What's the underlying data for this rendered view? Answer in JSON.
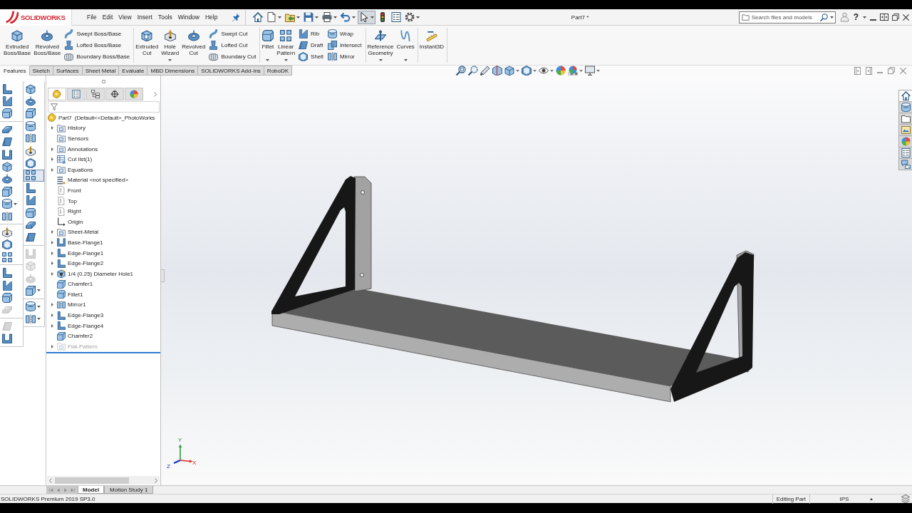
{
  "title_bar": {
    "logo": "SOLIDWORKS",
    "menu": [
      "File",
      "Edit",
      "View",
      "Insert",
      "Tools",
      "Window",
      "Help"
    ],
    "quick_access": [
      {
        "dropdown": false,
        "selected": false
      },
      {
        "dropdown": true,
        "selected": false
      },
      {
        "dropdown": true,
        "selected": false
      },
      {
        "dropdown": true,
        "selected": false
      },
      {
        "dropdown": true,
        "selected": false
      },
      {
        "dropdown": true,
        "selected": false
      },
      {
        "dropdown": true,
        "selected": true
      },
      {
        "dropdown": false,
        "selected": false
      },
      {
        "dropdown": false,
        "selected": false
      },
      {
        "dropdown": true,
        "selected": false
      }
    ],
    "document_title": "Part7 *",
    "search": {
      "placeholder": "Search files and models"
    },
    "help": "?"
  },
  "ribbon": {
    "groups": [
      {
        "large": [
          {
            "label": "Extruded Boss/Base",
            "dropdown": false
          },
          {
            "label": "Revolved Boss/Base",
            "dropdown": false
          }
        ],
        "small": [
          [
            "Swept Boss/Base",
            "Lofted Boss/Base",
            "Boundary Boss/Base"
          ]
        ]
      },
      {
        "large": [
          {
            "label": "Extruded Cut",
            "dropdown": false
          },
          {
            "label": "Hole Wizard",
            "dropdown": true
          },
          {
            "label": "Revolved Cut",
            "dropdown": false
          }
        ],
        "small": [
          [
            "Swept Cut",
            "Lofted Cut",
            "Boundary Cut"
          ]
        ]
      },
      {
        "large": [
          {
            "label": "Fillet",
            "dropdown": true
          },
          {
            "label": "Linear Pattern",
            "dropdown": true
          }
        ],
        "small": [
          [
            "Rib",
            "Draft",
            "Shell"
          ],
          [
            "Wrap",
            "Intersect",
            "Mirror"
          ]
        ]
      },
      {
        "large": [
          {
            "label": "Reference Geometry",
            "dropdown": true
          },
          {
            "label": "Curves",
            "dropdown": true
          }
        ]
      },
      {
        "large": [
          {
            "label": "Instant3D",
            "dropdown": false
          }
        ]
      }
    ]
  },
  "command_tabs": [
    {
      "label": "Features",
      "selected": true
    },
    {
      "label": "Sketch",
      "selected": false
    },
    {
      "label": "Surfaces",
      "selected": false
    },
    {
      "label": "Sheet Metal",
      "selected": false
    },
    {
      "label": "Evaluate",
      "selected": false
    },
    {
      "label": "MBD Dimensions",
      "selected": false
    },
    {
      "label": "SOLIDWORKS Add-Ins",
      "selected": false
    },
    {
      "label": "RoboDK",
      "selected": false
    }
  ],
  "view_toolbar": [
    {
      "dropdown": false
    },
    {
      "dropdown": false
    },
    {
      "dropdown": false
    },
    {
      "dropdown": false
    },
    {
      "dropdown": true
    },
    {
      "dropdown": true
    },
    {
      "dropdown": true
    },
    {
      "dropdown": false
    },
    {
      "dropdown": true
    },
    {
      "dropdown": true
    }
  ],
  "toolbars": [
    {
      "groups": [
        [
          {
            "selected": false,
            "disabled": false,
            "dropdown": false
          },
          {
            "selected": false,
            "disabled": false,
            "dropdown": false
          },
          {
            "selected": false,
            "disabled": false,
            "dropdown": false
          }
        ],
        [
          {
            "selected": false,
            "disabled": false,
            "dropdown": false
          },
          {
            "selected": false,
            "disabled": false,
            "dropdown": false
          },
          {
            "selected": false,
            "disabled": false,
            "dropdown": false
          },
          {
            "selected": false,
            "disabled": false,
            "dropdown": false
          },
          {
            "selected": false,
            "disabled": false,
            "dropdown": false
          },
          {
            "selected": false,
            "disabled": false,
            "dropdown": false
          },
          {
            "selected": false,
            "disabled": false,
            "dropdown": true
          },
          {
            "selected": false,
            "disabled": false,
            "dropdown": false
          }
        ],
        [
          {
            "selected": false,
            "disabled": false,
            "dropdown": false
          },
          {
            "selected": false,
            "disabled": false,
            "dropdown": false
          },
          {
            "selected": false,
            "disabled": false,
            "dropdown": false
          }
        ],
        [
          {
            "selected": false,
            "disabled": false,
            "dropdown": false
          },
          {
            "selected": false,
            "disabled": false,
            "dropdown": false
          },
          {
            "selected": false,
            "disabled": false,
            "dropdown": false
          },
          {
            "selected": false,
            "disabled": true,
            "dropdown": false
          }
        ],
        [
          {
            "selected": false,
            "disabled": true,
            "dropdown": false
          },
          {
            "selected": false,
            "disabled": false,
            "dropdown": false
          }
        ]
      ]
    },
    {
      "groups": [
        [
          {
            "selected": false,
            "disabled": false,
            "dropdown": false
          },
          {
            "selected": false,
            "disabled": false,
            "dropdown": false
          },
          {
            "selected": false,
            "disabled": false,
            "dropdown": false
          },
          {
            "selected": false,
            "disabled": false,
            "dropdown": false
          },
          {
            "selected": false,
            "disabled": false,
            "dropdown": false
          },
          {
            "selected": false,
            "disabled": false,
            "dropdown": false
          },
          {
            "selected": false,
            "disabled": false,
            "dropdown": false
          },
          {
            "selected": true,
            "disabled": false,
            "dropdown": false
          },
          {
            "selected": false,
            "disabled": false,
            "dropdown": false
          },
          {
            "selected": false,
            "disabled": false,
            "dropdown": false
          },
          {
            "selected": false,
            "disabled": false,
            "dropdown": false
          },
          {
            "selected": false,
            "disabled": false,
            "dropdown": false
          },
          {
            "selected": false,
            "disabled": false,
            "dropdown": false
          }
        ],
        [
          {
            "selected": false,
            "disabled": true,
            "dropdown": false
          },
          {
            "selected": false,
            "disabled": true,
            "dropdown": false
          },
          {
            "selected": false,
            "disabled": true,
            "dropdown": false
          },
          {
            "selected": false,
            "disabled": false,
            "dropdown": true
          }
        ],
        [
          {
            "selected": false,
            "disabled": false,
            "dropdown": true
          },
          {
            "selected": false,
            "disabled": false,
            "dropdown": true
          }
        ]
      ]
    }
  ],
  "feature_tree": {
    "manager_tabs": [
      {
        "selected": true
      },
      {
        "selected": false
      },
      {
        "selected": false
      },
      {
        "selected": false
      },
      {
        "selected": false
      }
    ],
    "root": "Part7  (Default<<Default>_PhotoWorks",
    "items": [
      {
        "label": "History",
        "kind": "history",
        "expandable": true,
        "disabled": false
      },
      {
        "label": "Sensors",
        "kind": "sensors",
        "expandable": false,
        "disabled": false
      },
      {
        "label": "Annotations",
        "kind": "annotations",
        "expandable": true,
        "disabled": false
      },
      {
        "label": "Cut list(1)",
        "kind": "cut-list",
        "expandable": true,
        "disabled": false
      },
      {
        "label": "Equations",
        "kind": "equations",
        "expandable": true,
        "disabled": false
      },
      {
        "label": "Material <not specified>",
        "kind": "material",
        "expandable": false,
        "disabled": false
      },
      {
        "label": "Front",
        "kind": "plane",
        "expandable": false,
        "disabled": false
      },
      {
        "label": "Top",
        "kind": "plane",
        "expandable": false,
        "disabled": false
      },
      {
        "label": "Right",
        "kind": "plane",
        "expandable": false,
        "disabled": false
      },
      {
        "label": "Origin",
        "kind": "origin",
        "expandable": false,
        "disabled": false
      },
      {
        "label": "Sheet-Metal",
        "kind": "sheet-metal",
        "expandable": true,
        "disabled": false
      },
      {
        "label": "Base-Flange1",
        "kind": "base-flange",
        "expandable": true,
        "disabled": false
      },
      {
        "label": "Edge-Flange1",
        "kind": "edge-flange",
        "expandable": true,
        "disabled": false
      },
      {
        "label": "Edge-Flange2",
        "kind": "edge-flange",
        "expandable": true,
        "disabled": false
      },
      {
        "label": "1/4 (0.25) Diameter Hole1",
        "kind": "hole",
        "expandable": true,
        "disabled": false
      },
      {
        "label": "Chamfer1",
        "kind": "chamfer",
        "expandable": false,
        "disabled": false
      },
      {
        "label": "Fillet1",
        "kind": "fillet",
        "expandable": false,
        "disabled": false
      },
      {
        "label": "Mirror1",
        "kind": "mirror",
        "expandable": true,
        "disabled": false
      },
      {
        "label": "Edge-Flange3",
        "kind": "edge-flange",
        "expandable": true,
        "disabled": false
      },
      {
        "label": "Edge-Flange4",
        "kind": "edge-flange",
        "expandable": true,
        "disabled": false
      },
      {
        "label": "Chamfer2",
        "kind": "chamfer",
        "expandable": false,
        "disabled": false
      },
      {
        "label": "Flat-Pattern",
        "kind": "flat-pattern",
        "expandable": true,
        "disabled": true
      }
    ]
  },
  "viewport": {
    "triad_labels": [
      "Y",
      "X",
      "Z"
    ]
  },
  "task_pane": {
    "tabs": [
      {
        "selected": true
      },
      {
        "selected": false
      },
      {
        "selected": false
      },
      {
        "selected": false
      },
      {
        "selected": false
      },
      {
        "selected": false
      },
      {
        "selected": false
      }
    ]
  },
  "bottom_tabs": [
    {
      "label": "Model",
      "selected": true
    },
    {
      "label": "Motion Study 1",
      "selected": false
    }
  ],
  "status_bar": {
    "product": "SOLIDWORKS Premium 2019 SP3.0",
    "mode": "Editing Part",
    "units": "IPS"
  }
}
